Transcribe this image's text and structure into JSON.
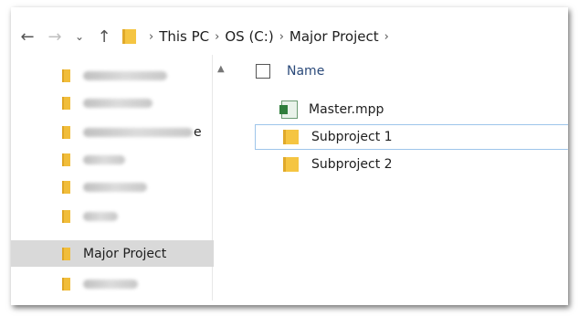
{
  "addressbar": {
    "breadcrumbs": [
      "This PC",
      "OS (C:)",
      "Major Project"
    ]
  },
  "sidebar": {
    "items": [
      {
        "label": "",
        "blurred": true
      },
      {
        "label": "",
        "blurred": true
      },
      {
        "label": "",
        "blurred": true,
        "trailing": "e"
      },
      {
        "label": "",
        "blurred": true
      },
      {
        "label": "",
        "blurred": true
      },
      {
        "label": "",
        "blurred": true
      },
      {
        "label": "Major Project",
        "selected": true
      },
      {
        "label": "",
        "blurred": true
      }
    ]
  },
  "main": {
    "column_header": "Name",
    "files": [
      {
        "name": "Master.mpp",
        "icon": "mpp-file-icon"
      },
      {
        "name": "Subproject 1",
        "icon": "folder-icon",
        "focused": true
      },
      {
        "name": "Subproject 2",
        "icon": "folder-icon"
      }
    ]
  },
  "colors": {
    "folder": "#f5c542",
    "selection": "#d9d9d9",
    "focus_outline": "#9ec5ea",
    "header_text": "#2b4a7a"
  }
}
